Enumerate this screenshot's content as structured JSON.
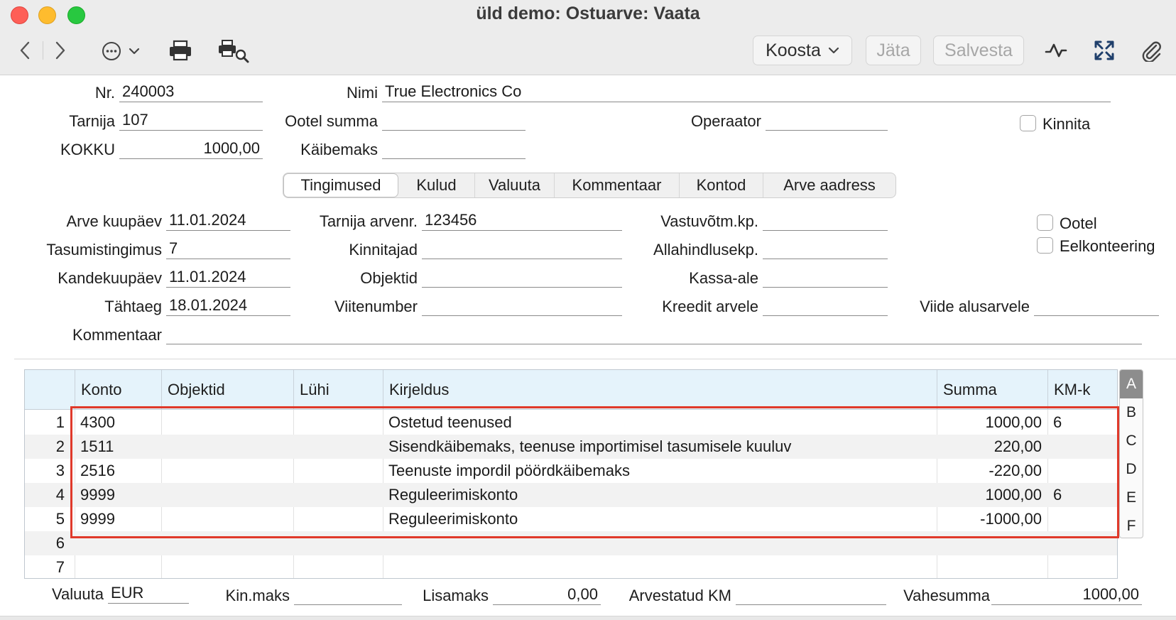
{
  "window": {
    "title": "üld demo: Ostuarve: Vaata"
  },
  "toolbar": {
    "koosta_label": "Koosta",
    "jata_label": "Jäta",
    "salvesta_label": "Salvesta"
  },
  "header": {
    "nr_label": "Nr.",
    "nr_value": "240003",
    "nimi_label": "Nimi",
    "nimi_value": "True Electronics Co",
    "tarnija_label": "Tarnija",
    "tarnija_value": "107",
    "ootel_summa_label": "Ootel summa",
    "ootel_summa_value": "",
    "operaator_label": "Operaator",
    "operaator_value": "",
    "kinnita_label": "Kinnita",
    "kokku_label": "KOKKU",
    "kokku_value": "1000,00",
    "kaibemaks_label": "Käibemaks",
    "kaibemaks_value": ""
  },
  "tabs": [
    {
      "label": "Tingimused",
      "active": true
    },
    {
      "label": "Kulud",
      "active": false
    },
    {
      "label": "Valuuta",
      "active": false
    },
    {
      "label": "Kommentaar",
      "active": false
    },
    {
      "label": "Kontod",
      "active": false
    },
    {
      "label": "Arve aadress",
      "active": false
    }
  ],
  "terms": {
    "arve_kuupaev_label": "Arve kuupäev",
    "arve_kuupaev_value": "11.01.2024",
    "tarnija_arvenr_label": "Tarnija arvenr.",
    "tarnija_arvenr_value": "123456",
    "vastuvotm_label": "Vastuvõtm.kp.",
    "vastuvotm_value": "",
    "ootel_label": "Ootel",
    "tasumistingimus_label": "Tasumistingimus",
    "tasumistingimus_value": "7",
    "kinnitajad_label": "Kinnitajad",
    "kinnitajad_value": "",
    "allahindlus_label": "Allahindlusekp.",
    "allahindlus_value": "",
    "eelkonteering_label": "Eelkonteering",
    "kandekuupaev_label": "Kandekuupäev",
    "kandekuupaev_value": "11.01.2024",
    "objektid_label": "Objektid",
    "objektid_value": "",
    "kassa_ale_label": "Kassa-ale",
    "kassa_ale_value": "",
    "tahtaeg_label": "Tähtaeg",
    "tahtaeg_value": "18.01.2024",
    "viitenumber_label": "Viitenumber",
    "viitenumber_value": "",
    "kreedit_label": "Kreedit arvele",
    "kreedit_value": "",
    "viide_label": "Viide alusarvele",
    "viide_value": "",
    "kommentaar_label": "Kommentaar",
    "kommentaar_value": ""
  },
  "grid": {
    "columns": [
      "Konto",
      "Objektid",
      "Lühi",
      "Kirjeldus",
      "Summa",
      "KM-k"
    ],
    "rows": [
      {
        "n": "1",
        "konto": "4300",
        "objektid": "",
        "luhi": "",
        "kirjeldus": "Ostetud teenused",
        "summa": "1000,00",
        "kmk": "6"
      },
      {
        "n": "2",
        "konto": "1511",
        "objektid": "",
        "luhi": "",
        "kirjeldus": "Sisendkäibemaks, teenuse importimisel tasumisele kuuluv",
        "summa": "220,00",
        "kmk": ""
      },
      {
        "n": "3",
        "konto": "2516",
        "objektid": "",
        "luhi": "",
        "kirjeldus": "Teenuste impordil pöördkäibemaks",
        "summa": "-220,00",
        "kmk": ""
      },
      {
        "n": "4",
        "konto": "9999",
        "objektid": "",
        "luhi": "",
        "kirjeldus": "Reguleerimiskonto",
        "summa": "1000,00",
        "kmk": "6"
      },
      {
        "n": "5",
        "konto": "9999",
        "objektid": "",
        "luhi": "",
        "kirjeldus": "Reguleerimiskonto",
        "summa": "-1000,00",
        "kmk": ""
      },
      {
        "n": "6",
        "konto": "",
        "objektid": "",
        "luhi": "",
        "kirjeldus": "",
        "summa": "",
        "kmk": ""
      },
      {
        "n": "7",
        "konto": "",
        "objektid": "",
        "luhi": "",
        "kirjeldus": "",
        "summa": "",
        "kmk": ""
      }
    ],
    "side_tabs": [
      "A",
      "B",
      "C",
      "D",
      "E",
      "F"
    ]
  },
  "footer": {
    "valuuta_label": "Valuuta",
    "valuuta_value": "EUR",
    "kinmaks_label": "Kin.maks",
    "kinmaks_value": "",
    "lisamaks_label": "Lisamaks",
    "lisamaks_value": "0,00",
    "arvestatud_km_label": "Arvestatud KM",
    "arvestatud_km_value": "",
    "vahesumma_label": "Vahesumma",
    "vahesumma_value": "1000,00"
  },
  "colors": {
    "highlight": "#e0392a",
    "grid_header": "#e5f3fb"
  }
}
